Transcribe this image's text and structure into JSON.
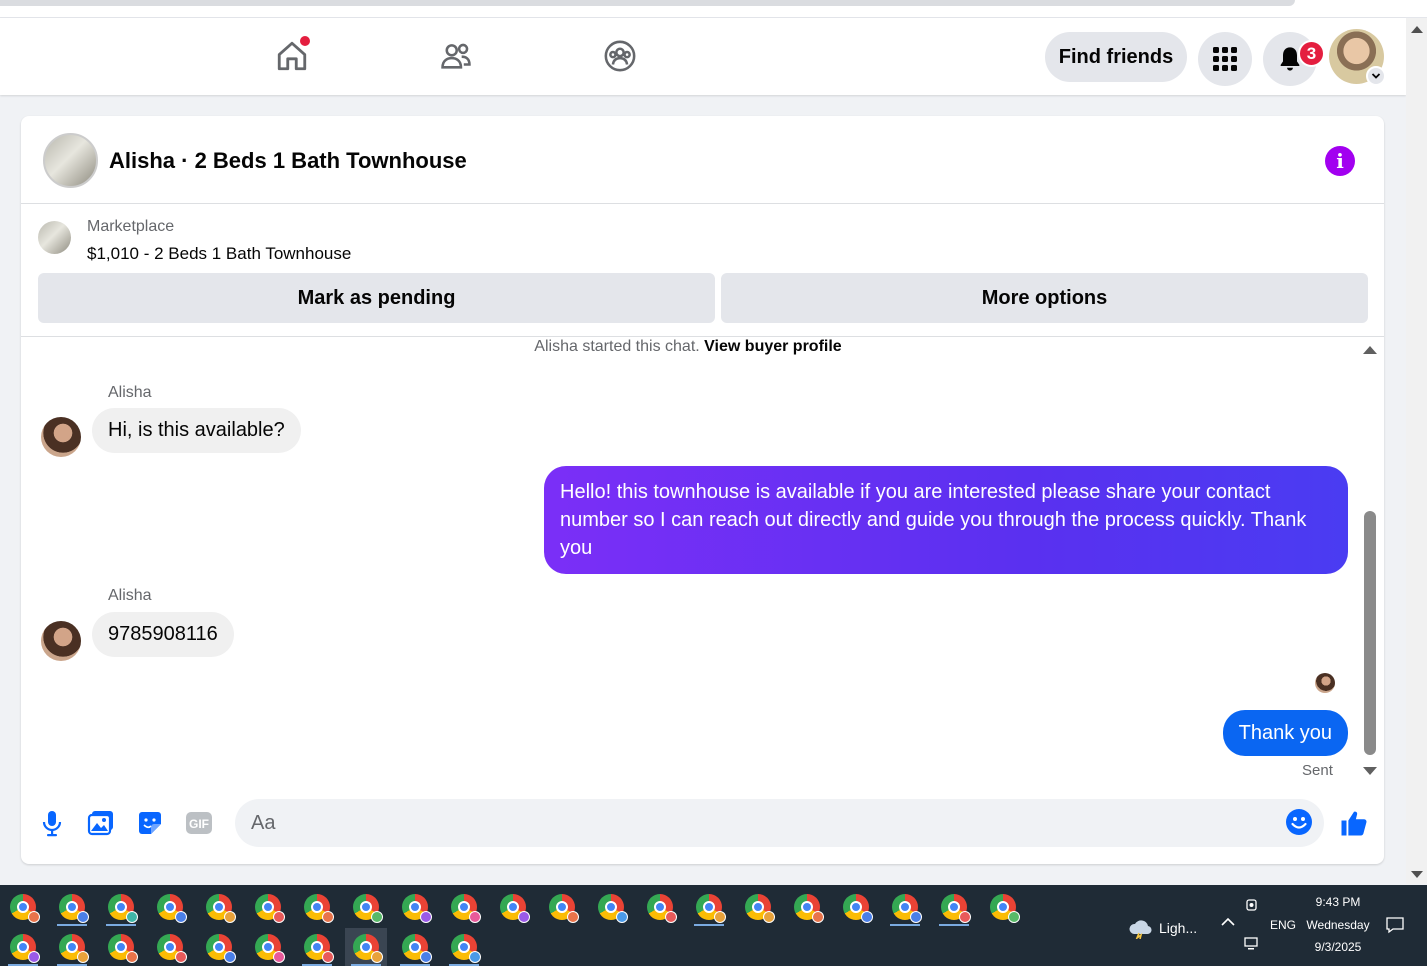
{
  "nav": {
    "find_friends_label": "Find friends",
    "notification_count": "3"
  },
  "chat": {
    "title": "Alisha · 2 Beds 1 Bath Townhouse",
    "marketplace_label": "Marketplace",
    "listing": "$1,010 - 2 Beds 1 Bath Townhouse",
    "mark_pending_label": "Mark as pending",
    "more_options_label": "More options",
    "started_text": "Alisha started this chat.",
    "view_buyer_label": "View buyer profile",
    "messages": [
      {
        "sender": "Alisha",
        "text": "Hi, is this available?",
        "direction": "in"
      },
      {
        "sender": "",
        "text": "Hello! this townhouse is available if you are interested please share your contact number so I can reach out directly and guide you through the process quickly. Thank you",
        "direction": "out"
      },
      {
        "sender": "Alisha",
        "text": "9785908116",
        "direction": "in"
      },
      {
        "sender": "",
        "text": "Thank you",
        "direction": "out"
      }
    ],
    "sent_status": "Sent",
    "composer_placeholder": "Aa"
  },
  "taskbar": {
    "weather": "Ligh...",
    "language": "ENG",
    "time": "9:43 PM",
    "day": "Wednesday",
    "date": "9/3/2025",
    "profile_badge_colors": [
      "#e8734a",
      "#4a7fe8",
      "#3fb6a8",
      "#4a7fe8",
      "#e8a23a",
      "#e85a5a",
      "#e8734a",
      "#58b968",
      "#9a5ae8",
      "#e85a9a",
      "#9a5ae8",
      "#e8734a",
      "#4a9ae8",
      "#e85a5a",
      "#e8a23a",
      "#e8a23a",
      "#e8734a",
      "#4a7fe8",
      "#4a7fe8",
      "#e85a5a",
      "#58b968",
      "#9a5ae8",
      "#e8a23a",
      "#e8734a",
      "#e85a5a",
      "#4a7fe8",
      "#e85a9a",
      "#e85a5a",
      "#e8a23a",
      "#4a7fe8",
      "#4a9ae8"
    ]
  },
  "colors": {
    "accent_purple": "#a200f0",
    "bubble_blue": "#0a66f2",
    "bubble_purple_start": "#7b2ff7",
    "notification_red": "#e41e3f"
  }
}
